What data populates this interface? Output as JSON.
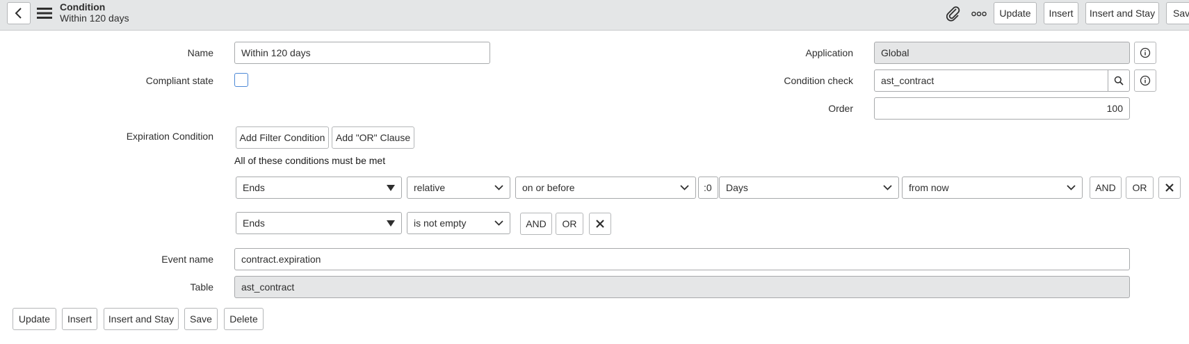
{
  "header": {
    "record_type": "Condition",
    "record_name": "Within 120 days",
    "buttons": {
      "update": "Update",
      "insert": "Insert",
      "insert_stay": "Insert and Stay",
      "save": "Save"
    }
  },
  "form": {
    "name": {
      "label": "Name",
      "value": "Within 120 days"
    },
    "compliant_state": {
      "label": "Compliant state",
      "checked": false
    },
    "application": {
      "label": "Application",
      "value": "Global"
    },
    "condition_check": {
      "label": "Condition check",
      "value": "ast_contract"
    },
    "order": {
      "label": "Order",
      "value": "100"
    },
    "expiration_condition": {
      "label": "Expiration Condition",
      "add_filter": "Add Filter Condition",
      "add_or": "Add \"OR\" Clause",
      "note": "All of these conditions must be met",
      "rows": [
        {
          "field": "Ends",
          "mode": "relative",
          "operator": "on or before",
          "amount": ":0",
          "unit": "Days",
          "direction": "from now",
          "and": "AND",
          "or": "OR"
        },
        {
          "field": "Ends",
          "operator": "is not empty",
          "and": "AND",
          "or": "OR"
        }
      ]
    },
    "event_name": {
      "label": "Event name",
      "value": "contract.expiration"
    },
    "table": {
      "label": "Table",
      "value": "ast_contract"
    }
  },
  "footer": {
    "update": "Update",
    "insert": "Insert",
    "insert_stay": "Insert and Stay",
    "save": "Save",
    "delete": "Delete"
  },
  "icons": [
    "back-icon",
    "menu-icon",
    "paperclip-icon",
    "more-options-icon",
    "info-icon",
    "search-icon",
    "chevron-down-icon",
    "caret-down-icon",
    "close-icon"
  ]
}
